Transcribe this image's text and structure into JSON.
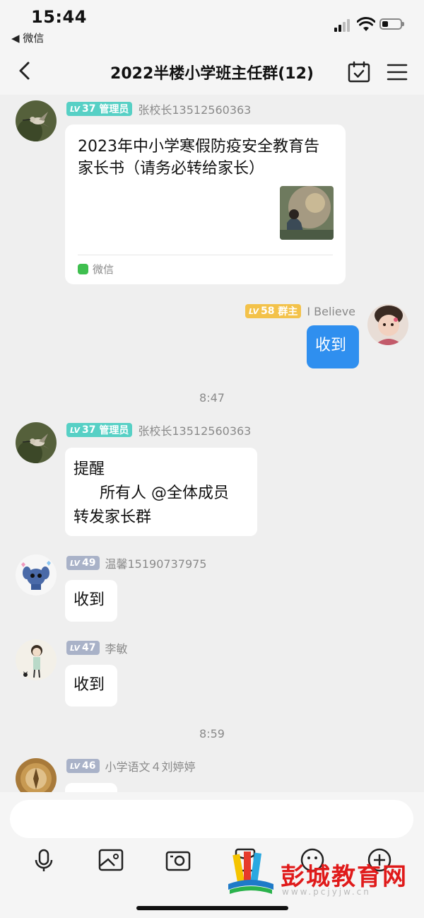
{
  "status_bar": {
    "time": "15:44",
    "back_app": "◀ 微信"
  },
  "nav": {
    "title": "2022半楼小学班主任群(12)"
  },
  "messages": {
    "m1": {
      "level": "37",
      "role": "管理员",
      "sender": "张校长13512560363",
      "card_title": "2023年中小学寒假防疫安全教育告家长书（请务必转给家长）",
      "card_source": "微信"
    },
    "m2": {
      "level": "58",
      "role": "群主",
      "sender": "I Believe",
      "text": "收到"
    },
    "t1": "8:47",
    "m3": {
      "level": "37",
      "role": "管理员",
      "sender": "张校长13512560363",
      "line1": "提醒",
      "line2": "所有人 @全体成员",
      "line3": "转发家长群"
    },
    "m4": {
      "level": "49",
      "sender": "温馨15190737975",
      "text": "收到"
    },
    "m5": {
      "level": "47",
      "sender": "李敏",
      "text": "收到"
    },
    "t2": "8:59",
    "m6": {
      "level": "46",
      "sender": "小学语文４刘婷婷"
    }
  },
  "level_prefix": "LV",
  "input": {
    "placeholder": ""
  },
  "watermark": {
    "text": "彭城教育网",
    "url": "www.pcjyjw.cn"
  },
  "colors": {
    "admin_badge": "#57d0c5",
    "owner_badge": "#f3c24a",
    "member_badge": "#a9b2c8",
    "own_bubble": "#2f8fef"
  },
  "icons": [
    "back-icon",
    "calendar-check-icon",
    "menu-icon",
    "voice-icon",
    "image-icon",
    "camera-icon",
    "red-packet-icon",
    "emoji-icon",
    "plus-icon"
  ]
}
